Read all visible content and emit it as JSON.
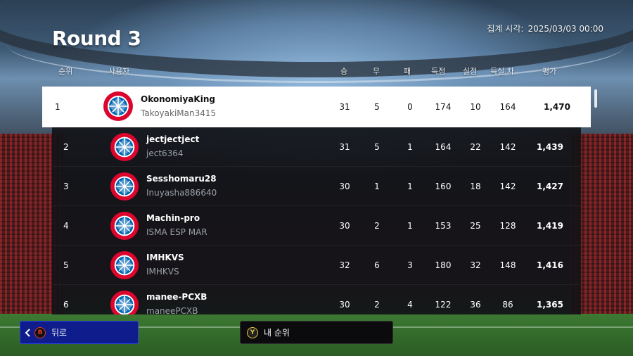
{
  "title": "Round 3",
  "aggregation": {
    "label": "집계 시각:",
    "value": "2025/03/03 00:00"
  },
  "headers": {
    "rank": "순위",
    "user": "사용자",
    "wins": "승",
    "draws": "무",
    "losses": "패",
    "goals_for": "득점",
    "goals_against": "실점",
    "goal_diff": "득실 차",
    "rating": "평가"
  },
  "rows": [
    {
      "rank": "1",
      "name": "OkonomiyaKing",
      "sub": "TakoyakiMan3415",
      "w": "31",
      "d": "5",
      "l": "0",
      "gf": "174",
      "ga": "10",
      "gd": "164",
      "rating": "1,470",
      "highlighted": true,
      "crest": "fc-bayern-crest-icon"
    },
    {
      "rank": "2",
      "name": "jectjectject",
      "sub": "ject6364",
      "w": "31",
      "d": "5",
      "l": "1",
      "gf": "164",
      "ga": "22",
      "gd": "142",
      "rating": "1,439",
      "crest": "fc-bayern-crest-icon"
    },
    {
      "rank": "3",
      "name": "Sesshomaru28",
      "sub": "Inuyasha886640",
      "w": "30",
      "d": "1",
      "l": "1",
      "gf": "160",
      "ga": "18",
      "gd": "142",
      "rating": "1,427",
      "crest": "fc-bayern-crest-icon"
    },
    {
      "rank": "4",
      "name": "Machin-pro",
      "sub": "ISMA ESP MAR",
      "w": "30",
      "d": "2",
      "l": "1",
      "gf": "153",
      "ga": "25",
      "gd": "128",
      "rating": "1,419",
      "crest": "fc-bayern-crest-icon"
    },
    {
      "rank": "5",
      "name": "IMHKVS",
      "sub": "IMHKVS",
      "w": "32",
      "d": "6",
      "l": "3",
      "gf": "180",
      "ga": "32",
      "gd": "148",
      "rating": "1,416",
      "crest": "fc-bayern-crest-icon"
    },
    {
      "rank": "6",
      "name": "manee-PCXB",
      "sub": "maneePCXB",
      "w": "30",
      "d": "2",
      "l": "4",
      "gf": "122",
      "ga": "36",
      "gd": "86",
      "rating": "1,365",
      "crest": "fc-bayern-crest-icon"
    }
  ],
  "footer": {
    "back": {
      "key": "B",
      "label": "뒤로",
      "icon": "chevron-left-icon"
    },
    "my_rank": {
      "key": "Y",
      "label": "내 순위"
    }
  },
  "colors": {
    "accent_blue": "#0f1c8c",
    "crest_red": "#dc052d",
    "crest_blue": "#0066b2"
  }
}
